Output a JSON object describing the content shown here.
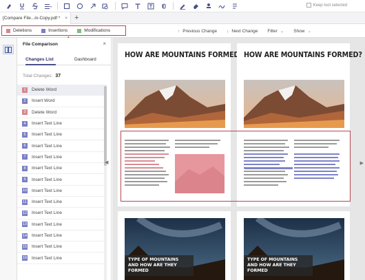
{
  "toolbar": {
    "icons": [
      "highlight-icon",
      "underline-icon",
      "strikethrough-icon",
      "lines-icon",
      "rectangle-icon",
      "circle-icon",
      "arrow-icon",
      "shape-icon",
      "comment-icon",
      "text-icon",
      "textbox-icon",
      "attach-icon",
      "pen-icon",
      "eraser-icon",
      "stamp-icon",
      "signature-icon",
      "more-icon"
    ],
    "keep_tool_selected": "Keep tool selected"
  },
  "tabs": {
    "active_tab": "[Compare  File...in-Copy.pdf *",
    "close": "×",
    "add": "+"
  },
  "compare_bar": {
    "legend": [
      {
        "label": "Deletions",
        "color": "#d8868d"
      },
      {
        "label": "Insertions",
        "color": "#7a80c4"
      },
      {
        "label": "Modifications",
        "color": "#7cbe84"
      }
    ],
    "previous_change": "Previous Change",
    "next_change": "Next Change",
    "filter": "Filter",
    "show": "Show"
  },
  "panel": {
    "title": "File Comparison",
    "close": "×",
    "tab_changes": "Changes List",
    "tab_dashboard": "Dashboard",
    "total_label": "Total Changes:",
    "total_value": "37",
    "items": [
      {
        "num": "1",
        "label": "Delete Word",
        "type": "del"
      },
      {
        "num": "2",
        "label": "Insert Word",
        "type": "ins"
      },
      {
        "num": "3",
        "label": "Delete Word",
        "type": "del"
      },
      {
        "num": "4",
        "label": "Insert Text Line",
        "type": "ins"
      },
      {
        "num": "5",
        "label": "Insert Text Line",
        "type": "ins"
      },
      {
        "num": "6",
        "label": "Insert Text Line",
        "type": "ins"
      },
      {
        "num": "7",
        "label": "Insert Text Line",
        "type": "ins"
      },
      {
        "num": "8",
        "label": "Insert Text Line",
        "type": "ins"
      },
      {
        "num": "9",
        "label": "Insert Text Line",
        "type": "ins"
      },
      {
        "num": "10",
        "label": "Insert Text Line",
        "type": "ins"
      },
      {
        "num": "11",
        "label": "Insert Text Line",
        "type": "ins"
      },
      {
        "num": "12",
        "label": "Insert Text Line",
        "type": "ins"
      },
      {
        "num": "13",
        "label": "Insert Text Line",
        "type": "ins"
      },
      {
        "num": "14",
        "label": "Insert Text Line",
        "type": "ins"
      },
      {
        "num": "15",
        "label": "Insert Text Line",
        "type": "ins"
      },
      {
        "num": "16",
        "label": "Insert Text Line",
        "type": "ins"
      }
    ]
  },
  "document": {
    "left_title": "HOW ARE MOUNTAINS FORMED?",
    "right_title": "HOW ARE MOUNTAINS FORMED?",
    "left_caption": "TYPE OF MOUNTAINS AND HOW ARE THEY FORMED",
    "right_caption": "TYPE OF MOUNTAINS AND HOW ARE THEY FORMED"
  }
}
